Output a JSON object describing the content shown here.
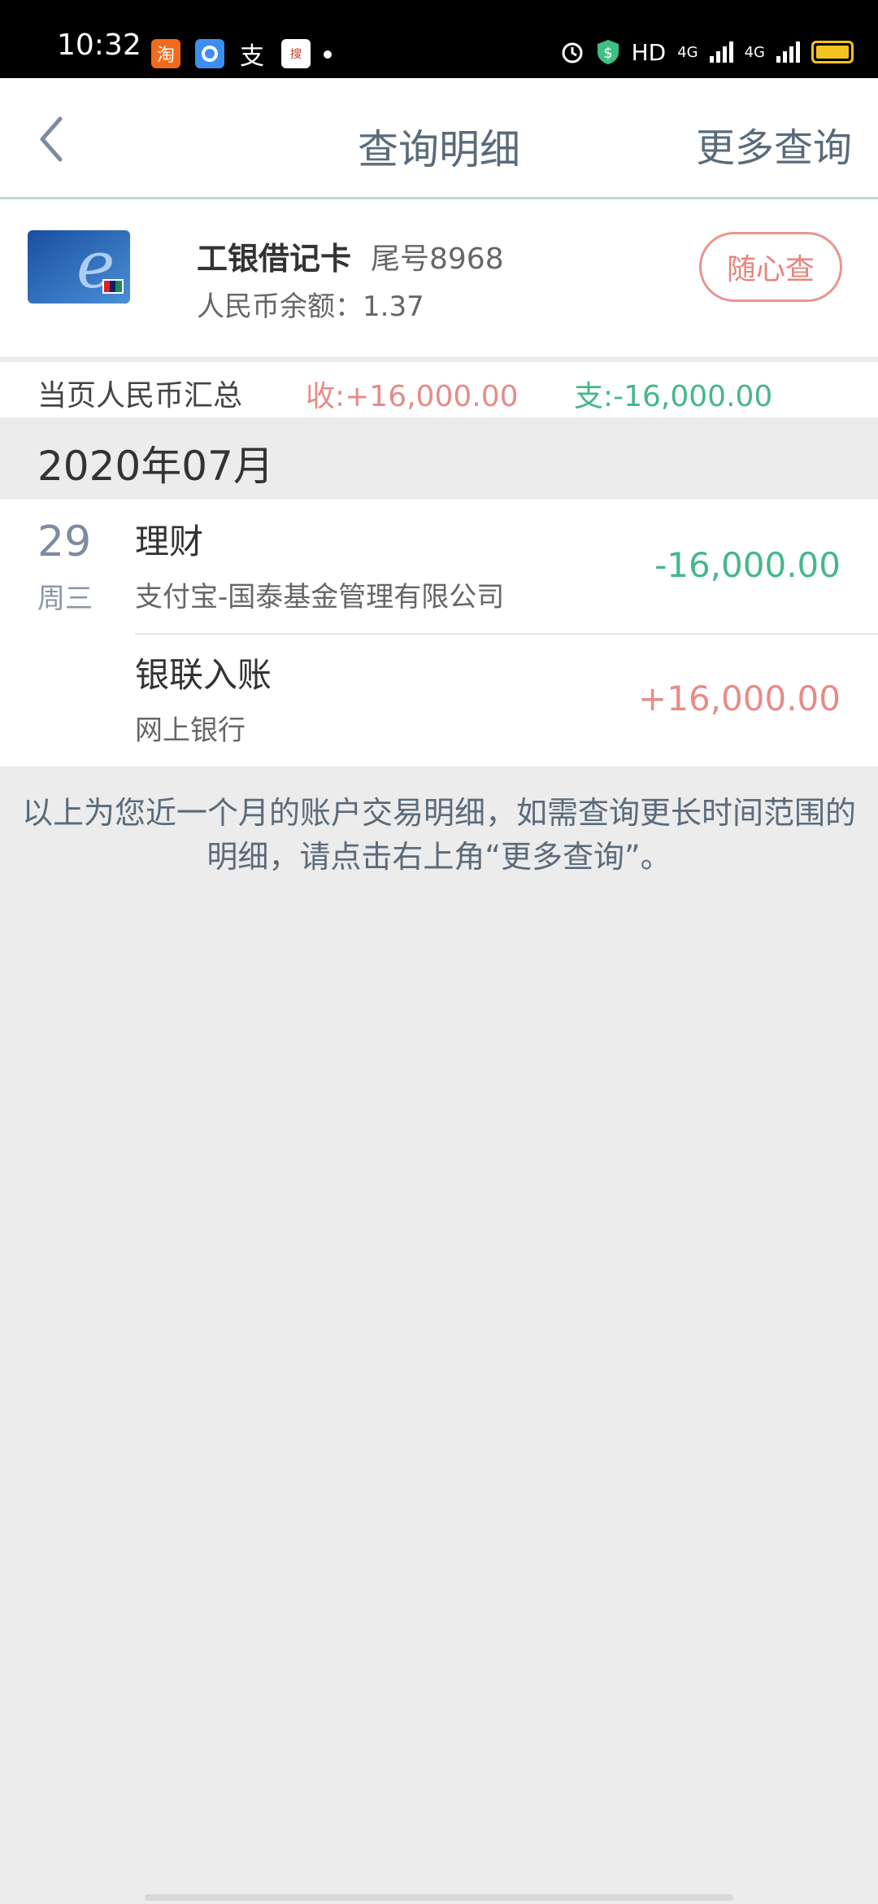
{
  "status_bar": {
    "time": "10:32",
    "icons": [
      "taobao-icon",
      "circle-app-icon",
      "alipay-icon",
      "news-app-icon"
    ],
    "right_text": "HD",
    "network": "4G",
    "network2": "4G"
  },
  "header": {
    "title": "查询明细",
    "more_label": "更多查询"
  },
  "card": {
    "name": "工银借记卡",
    "tail": "尾号8968",
    "balance": "人民币余额：1.37",
    "button_label": "随心查"
  },
  "summary": {
    "label": "当页人民币汇总",
    "income": "收:+16,000.00",
    "expense": "支:-16,000.00"
  },
  "month": "2020年07月",
  "transactions_date": {
    "day": "29",
    "weekday": "周三"
  },
  "transactions": [
    {
      "title": "理财",
      "subtitle": "支付宝-国泰基金管理有限公司",
      "amount": "-16,000.00"
    },
    {
      "title": "银联入账",
      "subtitle": "网上银行",
      "amount": "+16,000.00"
    }
  ],
  "note": "以上为您近一个月的账户交易明细，如需查询更长时间范围的明细，请点击右上角“更多查询”。",
  "colors": {
    "income": "#e88b87",
    "expense": "#45b78a",
    "title": "#5a6b7b"
  }
}
